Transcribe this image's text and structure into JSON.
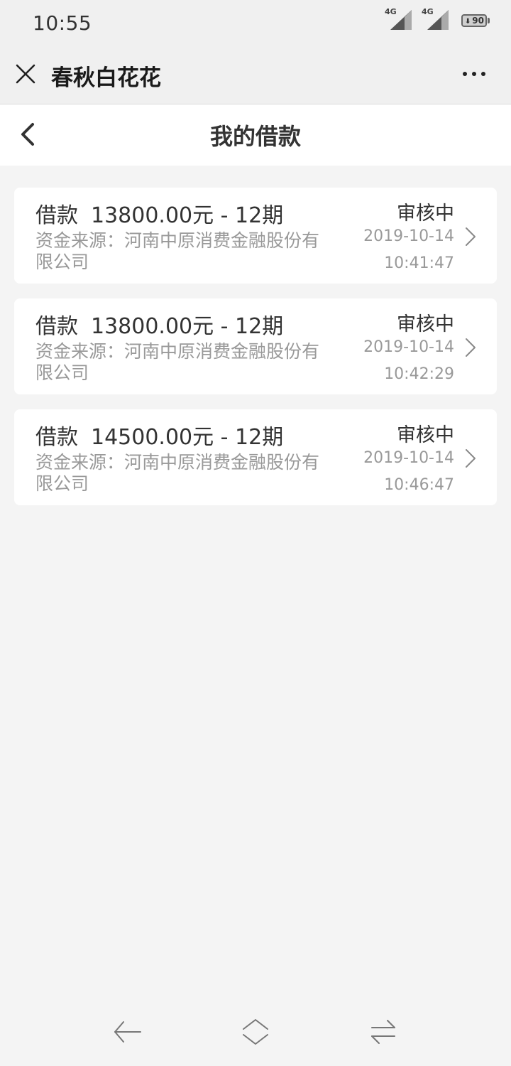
{
  "status_bar": {
    "time": "10:55",
    "network_1": "4G",
    "network_2": "4G",
    "battery": "90"
  },
  "title_bar": {
    "app_name": "春秋白花花",
    "close_icon": "close-icon",
    "more_icon": "more-dots-icon"
  },
  "page": {
    "title": "我的借款",
    "back_icon": "chevron-left-icon"
  },
  "loans": [
    {
      "label": "借款",
      "amount": "13800.00元 - 12期",
      "source": "资金来源：河南中原消费金融股份有限公司",
      "status": "审核中",
      "date": "2019-10-14",
      "time": "10:41:47"
    },
    {
      "label": "借款",
      "amount": "13800.00元 - 12期",
      "source": "资金来源：河南中原消费金融股份有限公司",
      "status": "审核中",
      "date": "2019-10-14",
      "time": "10:42:29"
    },
    {
      "label": "借款",
      "amount": "14500.00元 - 12期",
      "source": "资金来源：河南中原消费金融股份有限公司",
      "status": "审核中",
      "date": "2019-10-14",
      "time": "10:46:47"
    }
  ],
  "nav": {
    "back": "nav-back-icon",
    "home": "nav-home-icon",
    "recents": "nav-recents-icon"
  },
  "colors": {
    "background": "#f4f4f4",
    "card": "#ffffff",
    "primary_text": "#333333",
    "secondary_text": "#999999"
  }
}
